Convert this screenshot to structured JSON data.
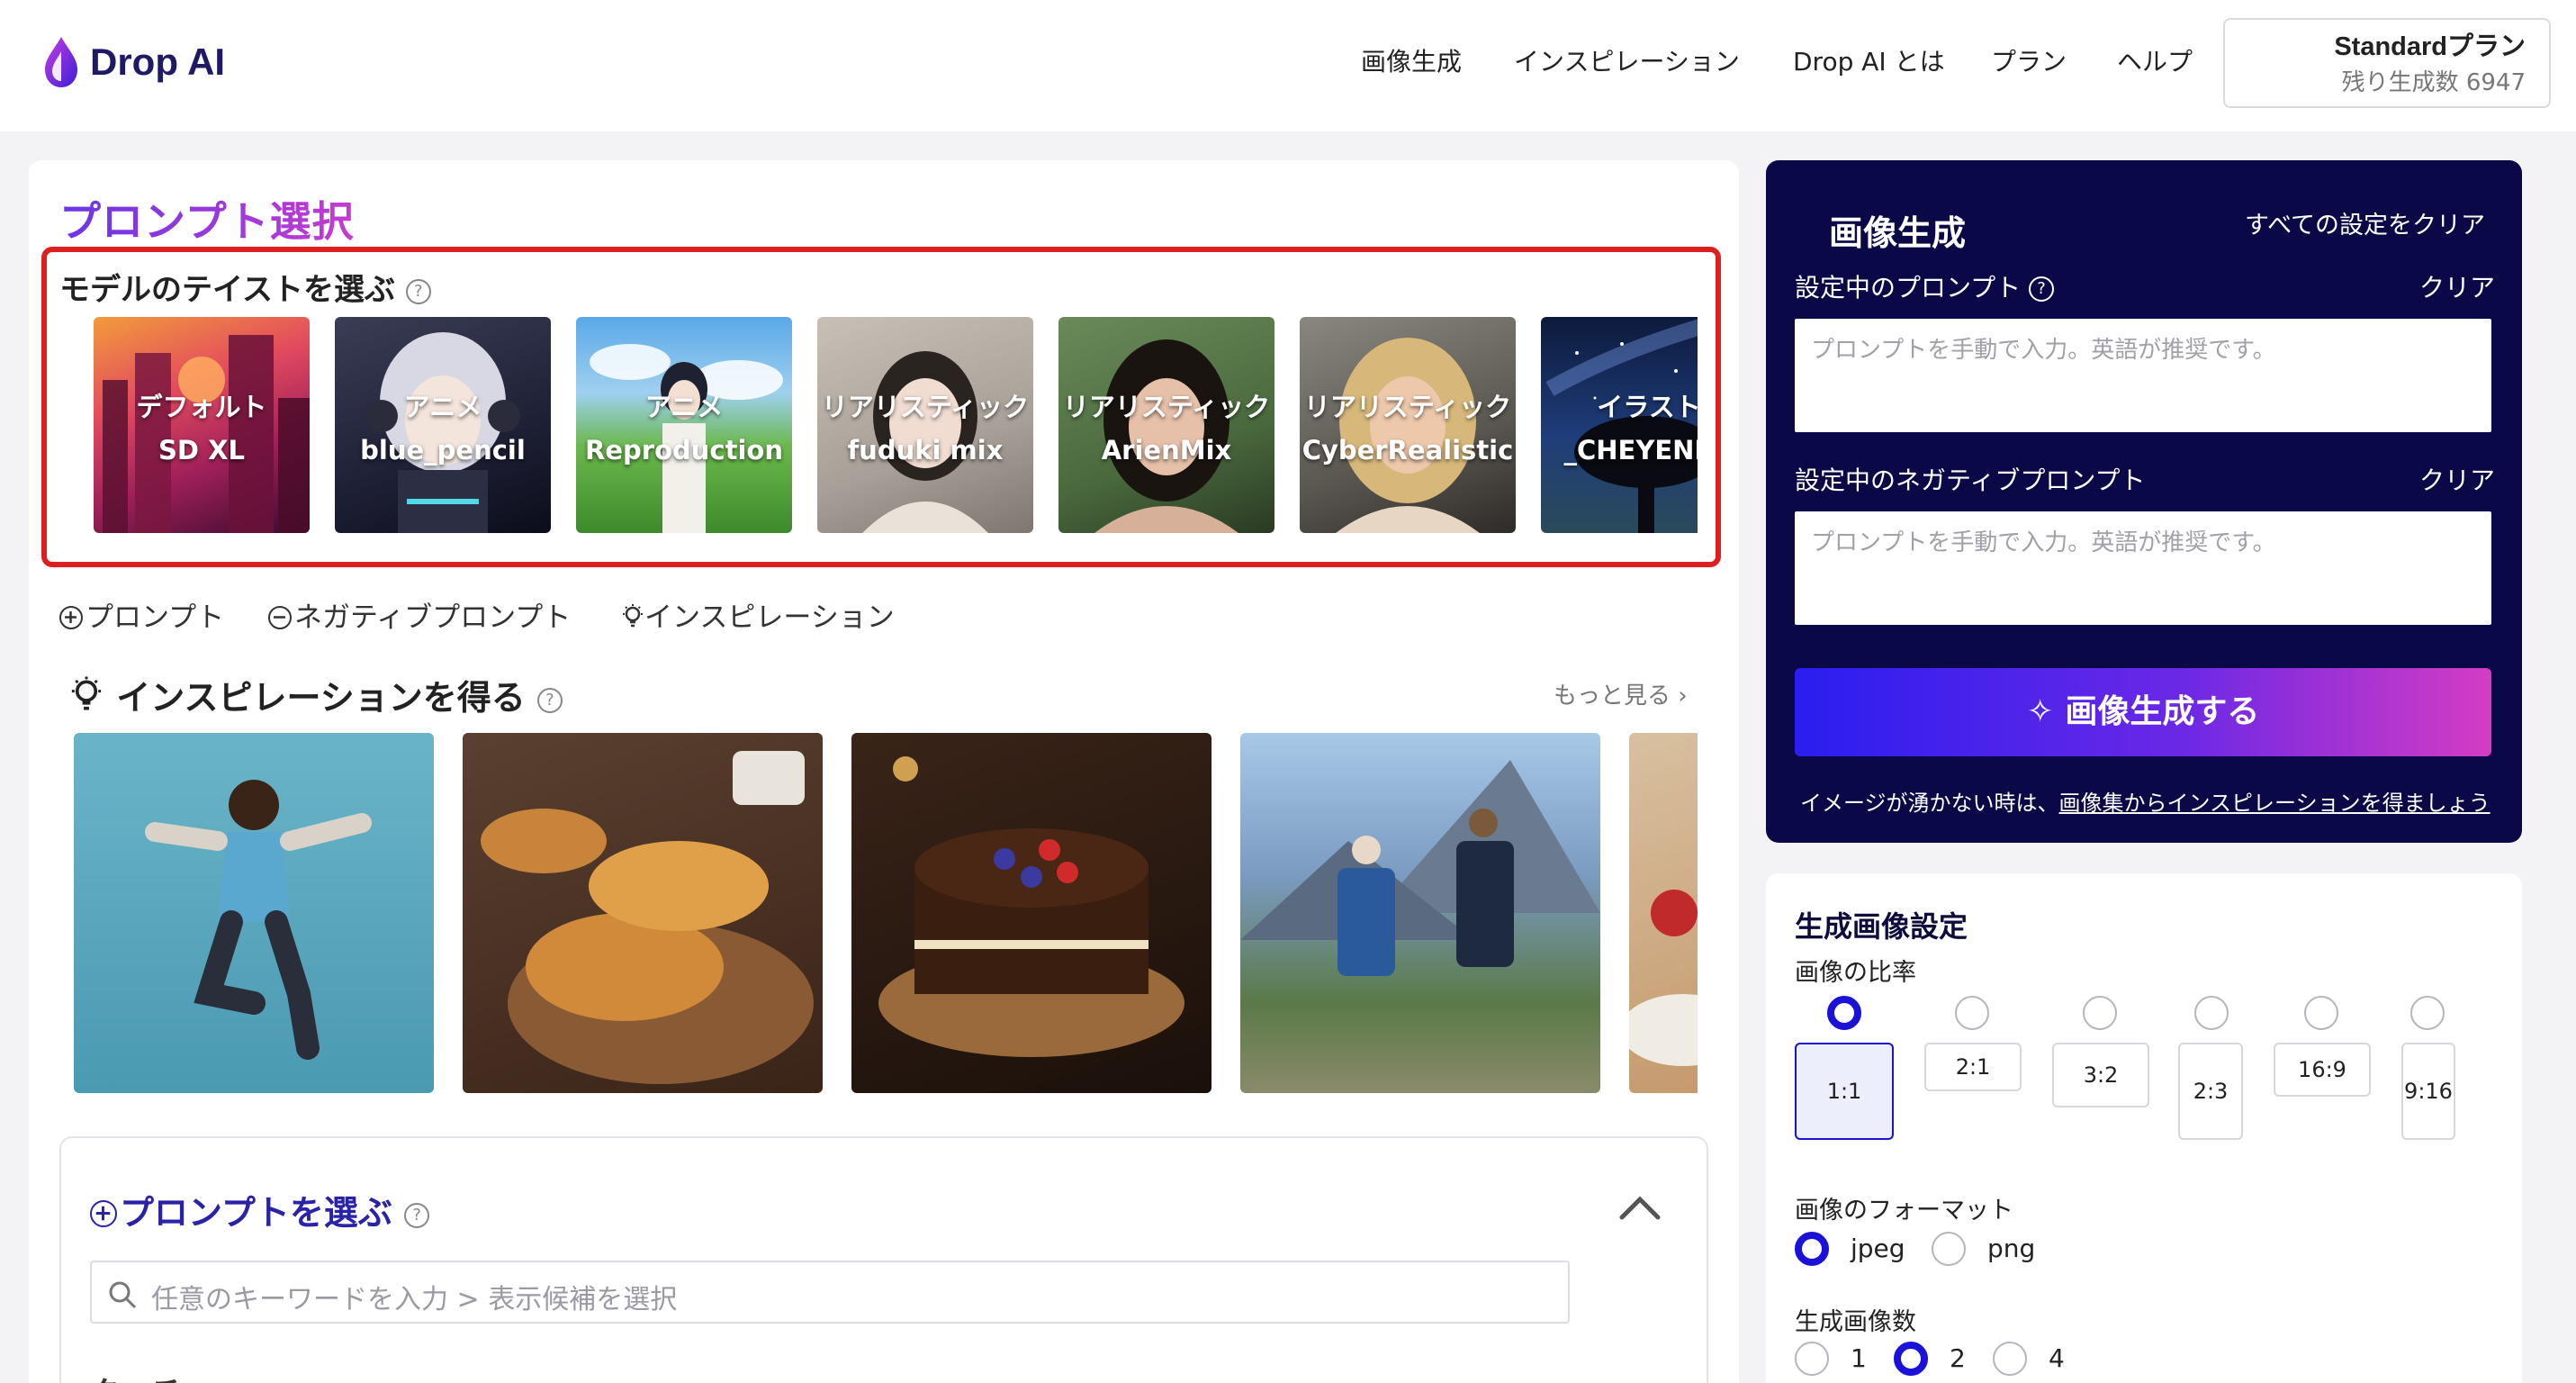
{
  "header": {
    "logo_text": "Drop AI",
    "nav": [
      "画像生成",
      "インスピレーション",
      "Drop AI とは",
      "プラン",
      "ヘルプ"
    ],
    "plan_name": "Standardプラン",
    "plan_remaining": "残り生成数 6947"
  },
  "prompt_section": {
    "title": "プロンプト選択",
    "model_label": "モデルのテイストを選ぶ",
    "models": [
      {
        "line1": "デフォルト",
        "line2": "SD XL"
      },
      {
        "line1": "アニメ",
        "line2": "blue_pencil"
      },
      {
        "line1": "アニメ",
        "line2": "Reproduction"
      },
      {
        "line1": "リアリスティック",
        "line2": "fuduki mix"
      },
      {
        "line1": "リアリスティック",
        "line2": "ArienMix"
      },
      {
        "line1": "リアリスティック",
        "line2": "CyberRealistic"
      },
      {
        "line1": "イラスト",
        "line2": "_CHEYENNE"
      }
    ],
    "tabs": [
      "プロンプト",
      "ネガティブプロンプト",
      "インスピレーション"
    ],
    "inspiration_heading": "インスピレーションを得る",
    "more_link": "もっと見る ›",
    "choose_heading": "プロンプトを選ぶ",
    "search_placeholder": "任意のキーワードを入力 > 表示候補を選択",
    "partial_text": "タッチ"
  },
  "generation": {
    "title": "画像生成",
    "clear_all": "すべての設定をクリア",
    "prompt_label": "設定中のプロンプト",
    "negative_label": "設定中のネガティブプロンプト",
    "clear": "クリア",
    "input_placeholder": "プロンプトを手動で入力。英語が推奨です。",
    "generate_button": "✧ 画像生成する",
    "hint_prefix": "イメージが湧かない時は、",
    "hint_link": "画像集からインスピレーションを得ましょう"
  },
  "settings": {
    "title": "生成画像設定",
    "ratio_label": "画像の比率",
    "ratios": [
      "1:1",
      "2:1",
      "3:2",
      "2:3",
      "16:9",
      "9:16"
    ],
    "selected_ratio": "1:1",
    "format_label": "画像のフォーマット",
    "formats": [
      "jpeg",
      "png"
    ],
    "selected_format": "jpeg",
    "count_label": "生成画像数",
    "counts": [
      "1",
      "2",
      "4"
    ],
    "selected_count": "2"
  },
  "colors": {
    "accent": "#1a12d8",
    "panel_dark": "#0a0847",
    "highlight_red": "#dd1f1f",
    "gradient_start": "#2a1ef0",
    "gradient_end": "#d53cc4"
  }
}
